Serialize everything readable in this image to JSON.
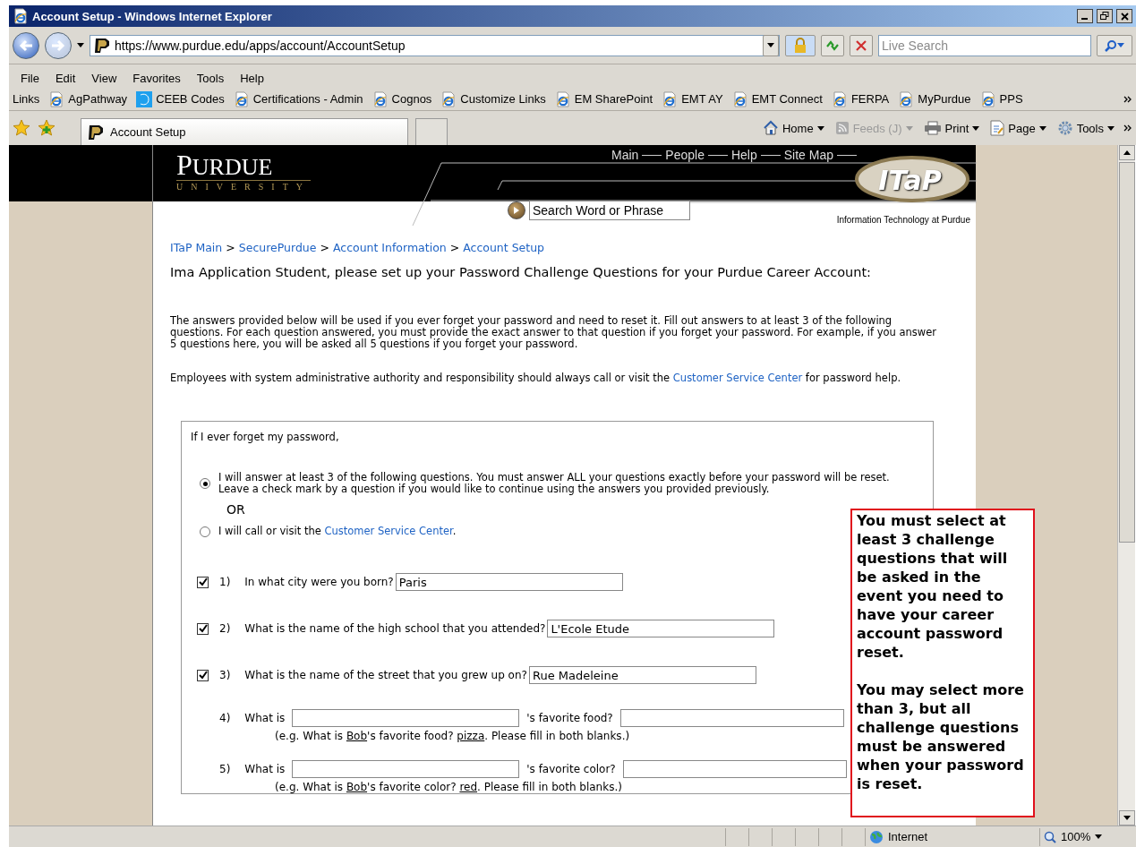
{
  "window": {
    "title": "Account Setup - Windows Internet Explorer"
  },
  "address_bar": {
    "url": "https://www.purdue.edu/apps/account/AccountSetup"
  },
  "search": {
    "placeholder": "Live Search"
  },
  "menu": [
    "File",
    "Edit",
    "View",
    "Favorites",
    "Tools",
    "Help"
  ],
  "links_bar": {
    "label": "Links",
    "items": [
      {
        "label": "AgPathway",
        "kind": "ie"
      },
      {
        "label": "CEEB Codes",
        "kind": "special"
      },
      {
        "label": "Certifications - Admin",
        "kind": "ie"
      },
      {
        "label": "Cognos",
        "kind": "ie"
      },
      {
        "label": "Customize Links",
        "kind": "ie"
      },
      {
        "label": "EM SharePoint",
        "kind": "ie"
      },
      {
        "label": "EMT AY",
        "kind": "ie"
      },
      {
        "label": "EMT Connect",
        "kind": "ie"
      },
      {
        "label": "FERPA",
        "kind": "ie"
      },
      {
        "label": "MyPurdue",
        "kind": "ie"
      },
      {
        "label": "PPS",
        "kind": "ie"
      }
    ]
  },
  "tabs": [
    {
      "label": "Account Setup",
      "selected": true
    }
  ],
  "command_bar": [
    {
      "label": "Home",
      "kind": "home",
      "disabled": false
    },
    {
      "label": "Feeds (J)",
      "kind": "feeds",
      "disabled": true
    },
    {
      "label": "Print",
      "kind": "print",
      "disabled": false
    },
    {
      "label": "Page",
      "kind": "page",
      "disabled": false
    },
    {
      "label": "Tools",
      "kind": "tools",
      "disabled": false
    }
  ],
  "page": {
    "header": {
      "logo_main": "PURDUE",
      "logo_sub": "UNIVERSITY",
      "nav": [
        "Main",
        "People",
        "Help",
        "Site Map"
      ],
      "search_value": "Search Word or Phrase",
      "itap_logo": "ITaP",
      "itap_tagline": "Information Technology at Purdue"
    },
    "breadcrumb": {
      "separator": ">",
      "items": [
        "ITaP Main",
        "SecurePurdue",
        "Account Information",
        "Account Setup"
      ]
    },
    "heading": "Ima Application Student, please set up your Password Challenge Questions for your Purdue Career Account:",
    "paragraphs": [
      {
        "text": "The answers provided below will be used if you ever forget your password and need to reset it. Fill out answers to at least 3 of the following questions. For each question answered, you must provide the exact answer to that question if you forget your password. For example, if you answer 5 questions here, you will be asked all 5 questions if you forget your password."
      },
      {
        "text": "Employees with system administrative authority and responsibility should always call or visit the ",
        "link": "Customer Service Center",
        "after": " for password help."
      }
    ],
    "form": {
      "intro": "If I ever forget my password,",
      "options": [
        {
          "selected": true,
          "text": "I will answer at least 3 of the following questions. You must answer ALL your questions exactly before your password will be reset. Leave a check mark by a question if you would like to continue using the answers you provided previously."
        },
        {
          "selected": false,
          "text": "I will call or visit the ",
          "link": "Customer Service Center",
          "after": "."
        }
      ],
      "or": "OR",
      "questions": [
        {
          "kind": "text",
          "checked": true,
          "number": "1)",
          "prompt": "In what city were you born?",
          "value": "Paris"
        },
        {
          "kind": "text",
          "checked": true,
          "number": "2)",
          "prompt": "What is the name of the high school that you attended?",
          "value": "L'Ecole Etude"
        },
        {
          "kind": "text",
          "checked": true,
          "number": "3)",
          "prompt": "What is the name of the street that you grew up on?",
          "value": "Rue Madeleine"
        },
        {
          "kind": "fill",
          "number": "4)",
          "prompt_start": "What is",
          "prompt_end": "'s favorite food?",
          "hint": [
            {
              "text": "(e.g. What is ",
              "underlined": false
            },
            {
              "text": "Bob",
              "underlined": true
            },
            {
              "text": "'s favorite food? ",
              "underlined": false
            },
            {
              "text": "pizza",
              "underlined": true
            },
            {
              "text": ". Please fill in both blanks.)",
              "underlined": false
            }
          ]
        },
        {
          "kind": "fill",
          "number": "5)",
          "prompt_start": "What is",
          "prompt_end": "'s favorite color?",
          "hint": [
            {
              "text": "(e.g. What is ",
              "underlined": false
            },
            {
              "text": "Bob",
              "underlined": true
            },
            {
              "text": "'s favorite color? ",
              "underlined": false
            },
            {
              "text": "red",
              "underlined": true
            },
            {
              "text": ". Please fill in both blanks.)",
              "underlined": false
            }
          ]
        }
      ]
    },
    "callout": [
      "You must select at least 3 challenge questions that will be asked in the event you need to have your career account password reset.",
      "You may select more than 3, but all challenge questions must be answered when your password is reset."
    ]
  },
  "status_bar": {
    "zone": "Internet",
    "zoom": "100%"
  }
}
